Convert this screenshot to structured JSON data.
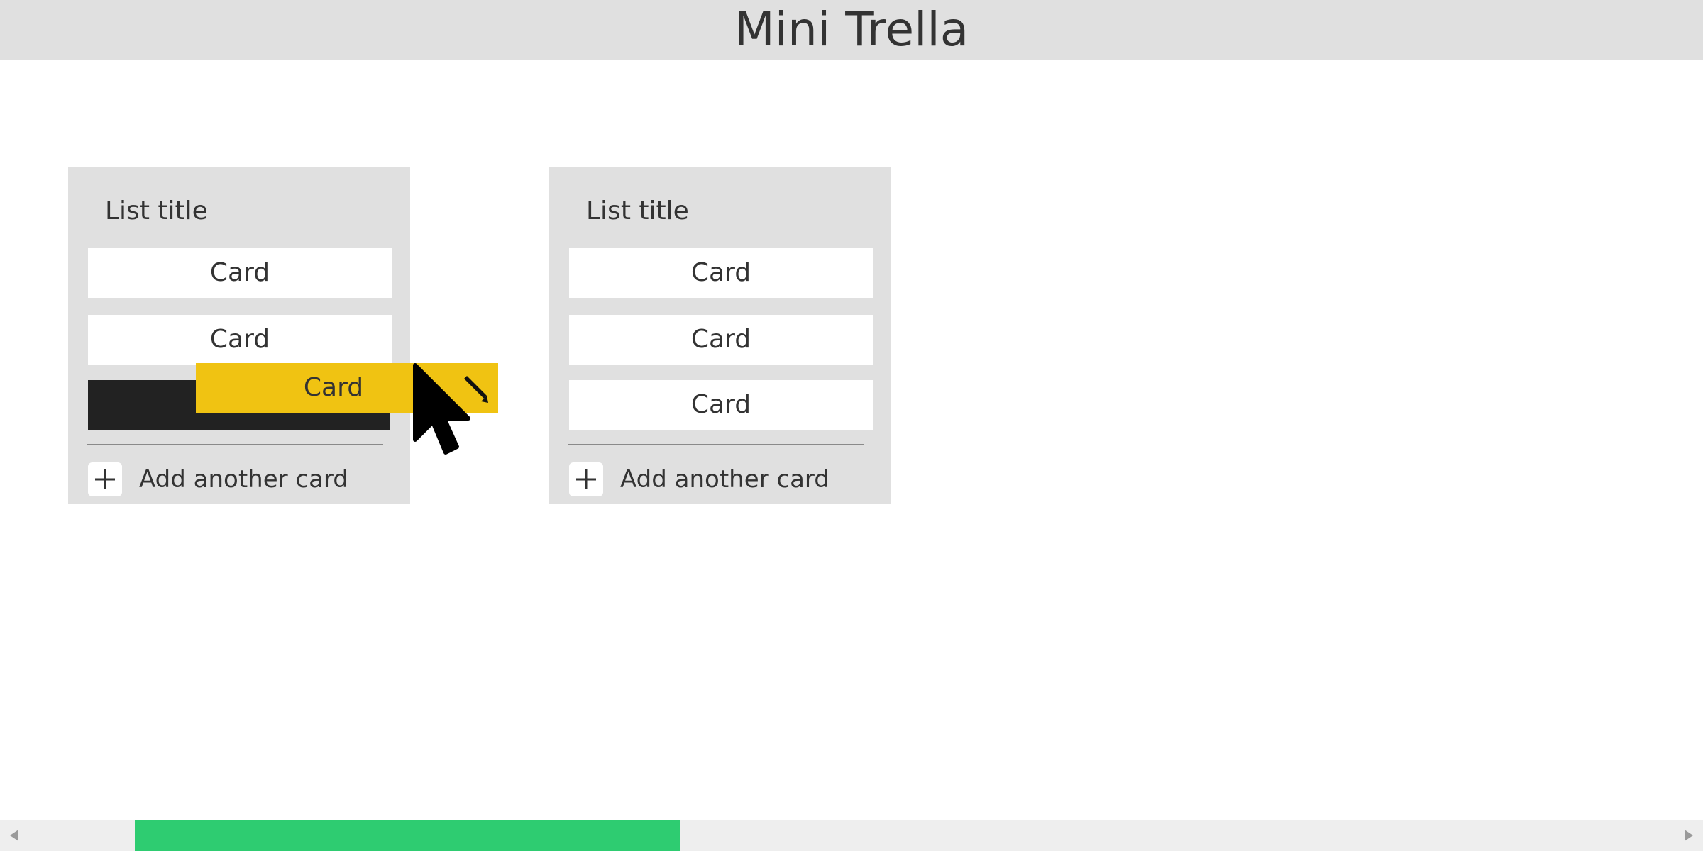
{
  "app": {
    "title": "Mini Trella"
  },
  "lists": [
    {
      "title": "List title",
      "cards": [
        "Card",
        "Card"
      ],
      "add_label": "Add another card"
    },
    {
      "title": "List title",
      "cards": [
        "Card",
        "Card",
        "Card"
      ],
      "add_label": "Add another card"
    }
  ],
  "dragging_card": {
    "label": "Card"
  },
  "colors": {
    "header_bg": "#e0e0e0",
    "list_bg": "#e0e0e0",
    "dragging_card_bg": "#f0c312",
    "placeholder_bg": "#222222",
    "scroll_thumb": "#2ecc71"
  },
  "icons": {
    "add": "plus-icon",
    "edit": "pencil-icon",
    "cursor": "mouse-pointer-icon",
    "scroll_left": "triangle-left-icon",
    "scroll_right": "triangle-right-icon"
  }
}
